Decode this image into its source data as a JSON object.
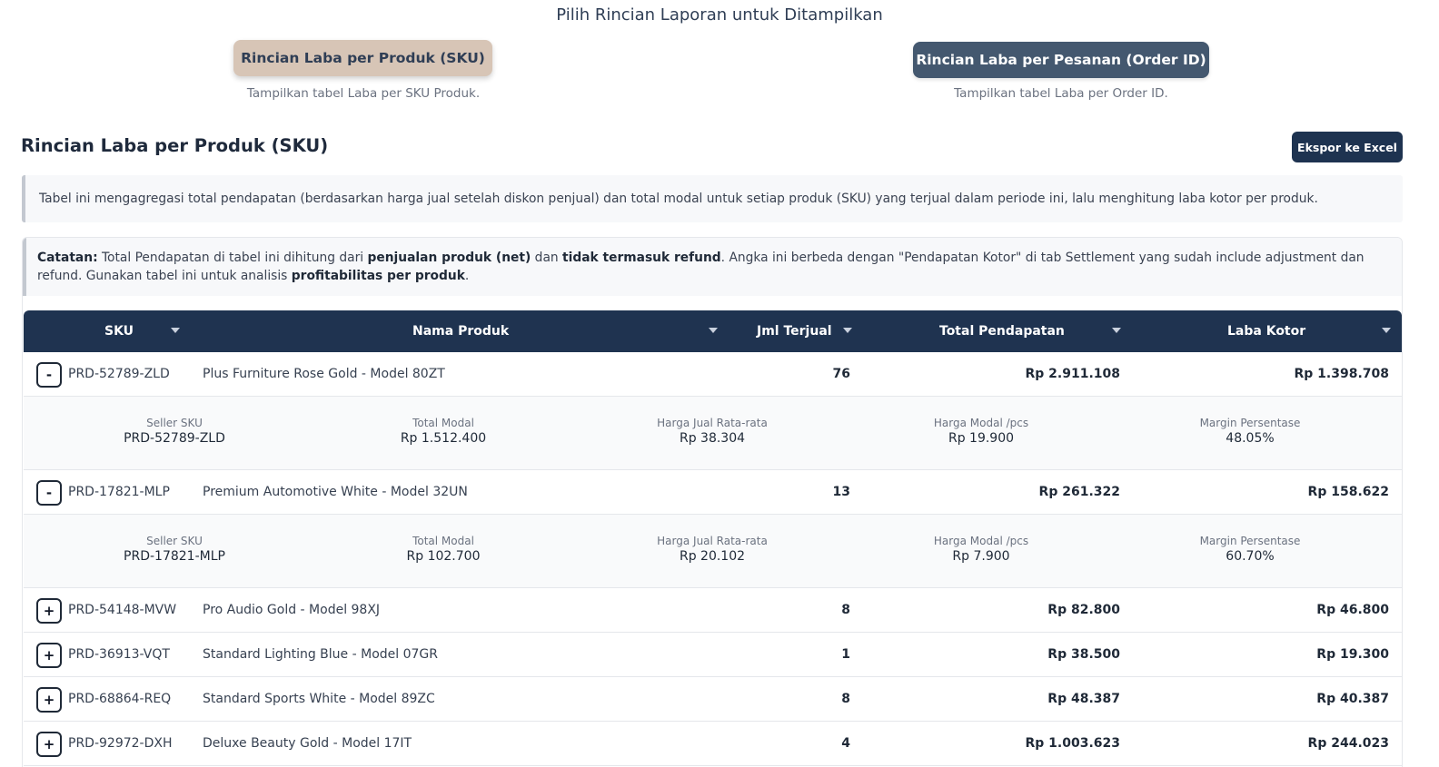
{
  "selector": {
    "title": "Pilih Rincian Laporan untuk Ditampilkan",
    "sku_button": "Rincian Laba per Produk (SKU)",
    "sku_hint": "Tampilkan tabel Laba per SKU Produk.",
    "order_button": "Rincian Laba per Pesanan (Order ID)",
    "order_hint": "Tampilkan tabel Laba per Order ID."
  },
  "section": {
    "title": "Rincian Laba per Produk (SKU)",
    "export_button": "Ekspor ke Excel",
    "info": "Tabel ini mengagregasi total pendapatan (berdasarkan harga jual setelah diskon penjual) dan total modal untuk setiap produk (SKU) yang terjual dalam periode ini, lalu menghitung laba kotor per produk."
  },
  "note": {
    "label": "Catatan:",
    "t1": " Total Pendapatan di tabel ini dihitung dari ",
    "b1": "penjualan produk (net)",
    "t2": " dan ",
    "b2": "tidak termasuk refund",
    "t3": ". Angka ini berbeda dengan \"Pendapatan Kotor\" di tab Settlement yang sudah include adjustment dan refund. Gunakan tabel ini untuk analisis ",
    "b3": "profitabilitas per produk",
    "t4": "."
  },
  "table": {
    "headers": {
      "sku": "SKU",
      "name": "Nama Produk",
      "qty": "Jml Terjual",
      "revenue": "Total Pendapatan",
      "profit": "Laba Kotor"
    },
    "detail_labels": {
      "seller_sku": "Seller SKU",
      "total_cost": "Total Modal",
      "avg_price": "Harga Jual Rata-rata",
      "unit_cost": "Harga Modal /pcs",
      "margin": "Margin Persentase"
    },
    "rows": [
      {
        "toggle": "-",
        "sku": "PRD-52789-ZLD",
        "name": "Plus Furniture Rose Gold - Model 80ZT",
        "qty": "76",
        "revenue": "Rp 2.911.108",
        "profit": "Rp 1.398.708",
        "detail": {
          "seller_sku": "PRD-52789-ZLD",
          "total_cost": "Rp 1.512.400",
          "avg_price": "Rp 38.304",
          "unit_cost": "Rp 19.900",
          "margin": "48.05%"
        }
      },
      {
        "toggle": "-",
        "sku": "PRD-17821-MLP",
        "name": "Premium Automotive White - Model 32UN",
        "qty": "13",
        "revenue": "Rp 261.322",
        "profit": "Rp 158.622",
        "detail": {
          "seller_sku": "PRD-17821-MLP",
          "total_cost": "Rp 102.700",
          "avg_price": "Rp 20.102",
          "unit_cost": "Rp 7.900",
          "margin": "60.70%"
        }
      },
      {
        "toggle": "+",
        "sku": "PRD-54148-MVW",
        "name": "Pro Audio Gold - Model 98XJ",
        "qty": "8",
        "revenue": "Rp 82.800",
        "profit": "Rp 46.800"
      },
      {
        "toggle": "+",
        "sku": "PRD-36913-VQT",
        "name": "Standard Lighting Blue - Model 07GR",
        "qty": "1",
        "revenue": "Rp 38.500",
        "profit": "Rp 19.300"
      },
      {
        "toggle": "+",
        "sku": "PRD-68864-REQ",
        "name": "Standard Sports White - Model 89ZC",
        "qty": "8",
        "revenue": "Rp 48.387",
        "profit": "Rp 40.387"
      },
      {
        "toggle": "+",
        "sku": "PRD-92972-DXH",
        "name": "Deluxe Beauty Gold - Model 17IT",
        "qty": "4",
        "revenue": "Rp 1.003.623",
        "profit": "Rp 244.023"
      }
    ]
  }
}
